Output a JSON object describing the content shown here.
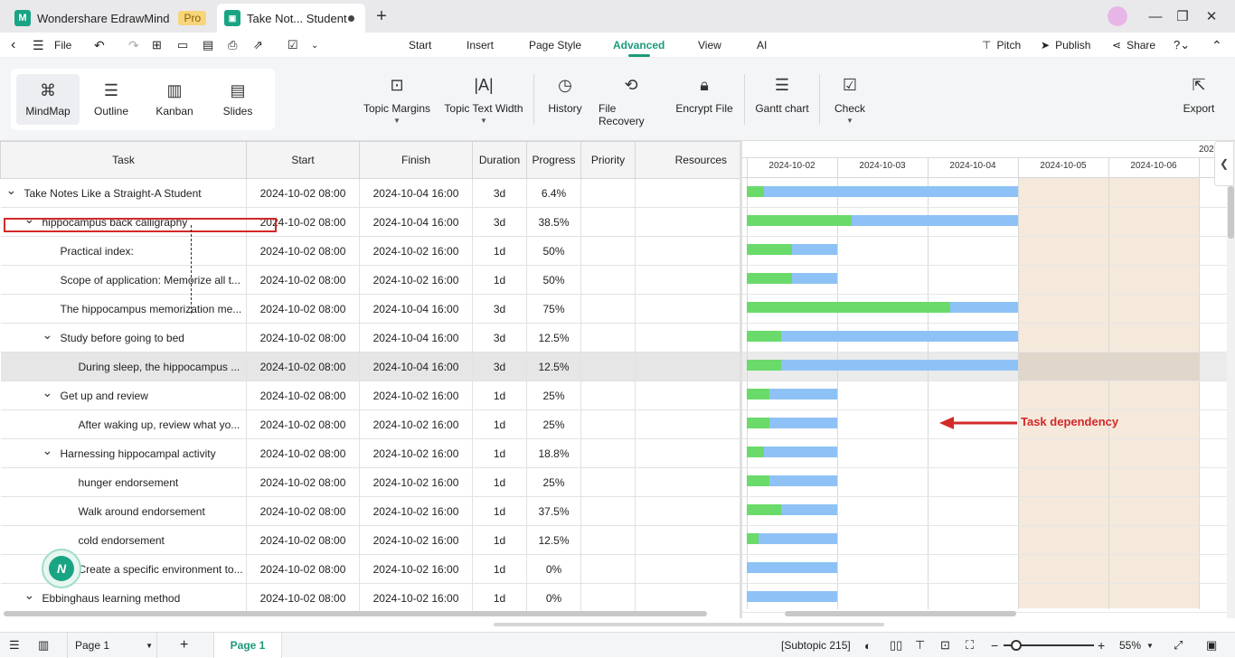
{
  "titlebar": {
    "app_tab": "Wondershare EdrawMind",
    "pro_badge": "Pro",
    "doc_tab": "Take Not... Student"
  },
  "menubar": {
    "file": "File",
    "tabs": [
      "Start",
      "Insert",
      "Page Style",
      "Advanced",
      "View",
      "AI"
    ],
    "active_tab": "Advanced",
    "pitch": "Pitch",
    "publish": "Publish",
    "share": "Share"
  },
  "toolbar": {
    "views": [
      "MindMap",
      "Outline",
      "Kanban",
      "Slides"
    ],
    "selected_view": "MindMap",
    "buttons": [
      "Topic Margins",
      "Topic Text Width",
      "History",
      "File Recovery",
      "Encrypt File",
      "Gantt chart",
      "Check",
      "Export"
    ]
  },
  "grid": {
    "columns": [
      "Task",
      "Start",
      "Finish",
      "Duration",
      "Progress",
      "Priority",
      "Resources"
    ],
    "rows": [
      {
        "task": "Take Notes Like a Straight-A Student",
        "start": "2024-10-02 08:00",
        "finish": "2024-10-04 16:00",
        "duration": "3d",
        "progress": "6.4%"
      },
      {
        "task": "hippocampus back calligraphy",
        "start": "2024-10-02 08:00",
        "finish": "2024-10-04 16:00",
        "duration": "3d",
        "progress": "38.5%"
      },
      {
        "task": "Practical index:",
        "start": "2024-10-02 08:00",
        "finish": "2024-10-02 16:00",
        "duration": "1d",
        "progress": "50%"
      },
      {
        "task": "Scope of application: Memorize all t...",
        "start": "2024-10-02 08:00",
        "finish": "2024-10-02 16:00",
        "duration": "1d",
        "progress": "50%"
      },
      {
        "task": "The hippocampus memorization me...",
        "start": "2024-10-02 08:00",
        "finish": "2024-10-04 16:00",
        "duration": "3d",
        "progress": "75%"
      },
      {
        "task": "Study before going to bed",
        "start": "2024-10-02 08:00",
        "finish": "2024-10-04 16:00",
        "duration": "3d",
        "progress": "12.5%"
      },
      {
        "task": "During sleep, the hippocampus ...",
        "start": "2024-10-02 08:00",
        "finish": "2024-10-04 16:00",
        "duration": "3d",
        "progress": "12.5%"
      },
      {
        "task": "Get up and review",
        "start": "2024-10-02 08:00",
        "finish": "2024-10-02 16:00",
        "duration": "1d",
        "progress": "25%"
      },
      {
        "task": "After waking up, review what yo...",
        "start": "2024-10-02 08:00",
        "finish": "2024-10-02 16:00",
        "duration": "1d",
        "progress": "25%"
      },
      {
        "task": "Harnessing hippocampal activity",
        "start": "2024-10-02 08:00",
        "finish": "2024-10-02 16:00",
        "duration": "1d",
        "progress": "18.8%"
      },
      {
        "task": "hunger endorsement",
        "start": "2024-10-02 08:00",
        "finish": "2024-10-02 16:00",
        "duration": "1d",
        "progress": "25%"
      },
      {
        "task": "Walk around endorsement",
        "start": "2024-10-02 08:00",
        "finish": "2024-10-02 16:00",
        "duration": "1d",
        "progress": "37.5%"
      },
      {
        "task": "cold endorsement",
        "start": "2024-10-02 08:00",
        "finish": "2024-10-02 16:00",
        "duration": "1d",
        "progress": "12.5%"
      },
      {
        "task": "Create a specific environment to...",
        "start": "2024-10-02 08:00",
        "finish": "2024-10-02 16:00",
        "duration": "1d",
        "progress": "0%"
      },
      {
        "task": "Ebbinghaus learning method",
        "start": "2024-10-02 08:00",
        "finish": "2024-10-02 16:00",
        "duration": "1d",
        "progress": "0%"
      }
    ]
  },
  "gantt": {
    "dates": [
      "2024-10-02",
      "2024-10-03",
      "2024-10-04",
      "2024-10-05",
      "2024-10-06"
    ],
    "next_date_partial": "202",
    "annotation": "Task dependency"
  },
  "statusbar": {
    "page_select": "Page 1",
    "page_tab": "Page 1",
    "subtopic": "[Subtopic 215]",
    "zoom": "55%"
  },
  "colors": {
    "accent": "#1b9a7a",
    "bar": "#8ec2f6",
    "progress": "#6ada6a",
    "weekend": "#f5e9dc",
    "highlight": "#d32828"
  }
}
